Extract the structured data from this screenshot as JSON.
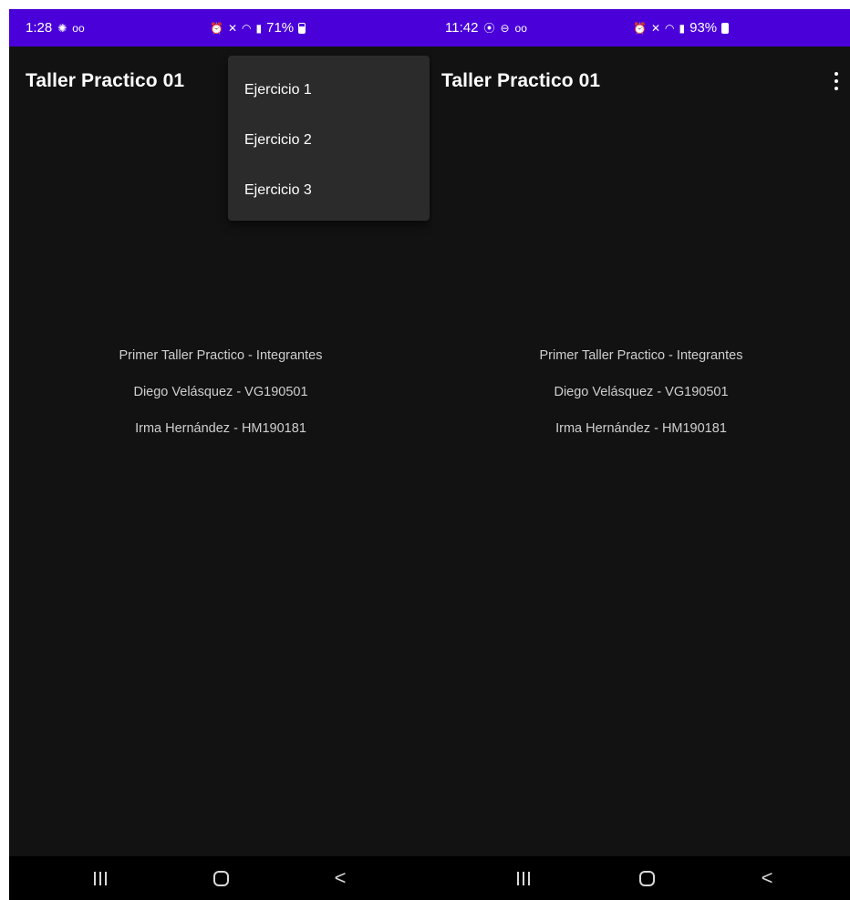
{
  "screens": [
    {
      "status": {
        "time": "1:28",
        "battery": "71%"
      },
      "app_bar": {
        "title": "Taller Practico 01"
      },
      "menu": {
        "items": [
          {
            "label": "Ejercicio 1"
          },
          {
            "label": "Ejercicio 2"
          },
          {
            "label": "Ejercicio 3"
          }
        ]
      },
      "content": {
        "lines": [
          "Primer Taller Practico - Integrantes",
          "Diego Velásquez - VG190501",
          "Irma Hernández - HM190181"
        ]
      }
    },
    {
      "status": {
        "time": "11:42",
        "battery": "93%"
      },
      "app_bar": {
        "title": "Taller Practico 01"
      },
      "content": {
        "lines": [
          "Primer Taller Practico - Integrantes",
          "Diego Velásquez - VG190501",
          "Irma Hernández - HM190181"
        ]
      }
    }
  ],
  "icons": {
    "status_left": [
      "brightness-icon",
      "voicemail-icon"
    ],
    "status_right": [
      "alarm-icon",
      "mute-icon",
      "wifi-icon",
      "signal-icon",
      "battery-icon"
    ],
    "nav": [
      "recents-icon",
      "home-icon",
      "back-icon"
    ],
    "app_bar": [
      "more-vert-icon"
    ]
  },
  "colors": {
    "status_bar": "#4a00d9",
    "background": "#121212",
    "menu": "#2b2b2b",
    "nav_bar": "#000000"
  }
}
